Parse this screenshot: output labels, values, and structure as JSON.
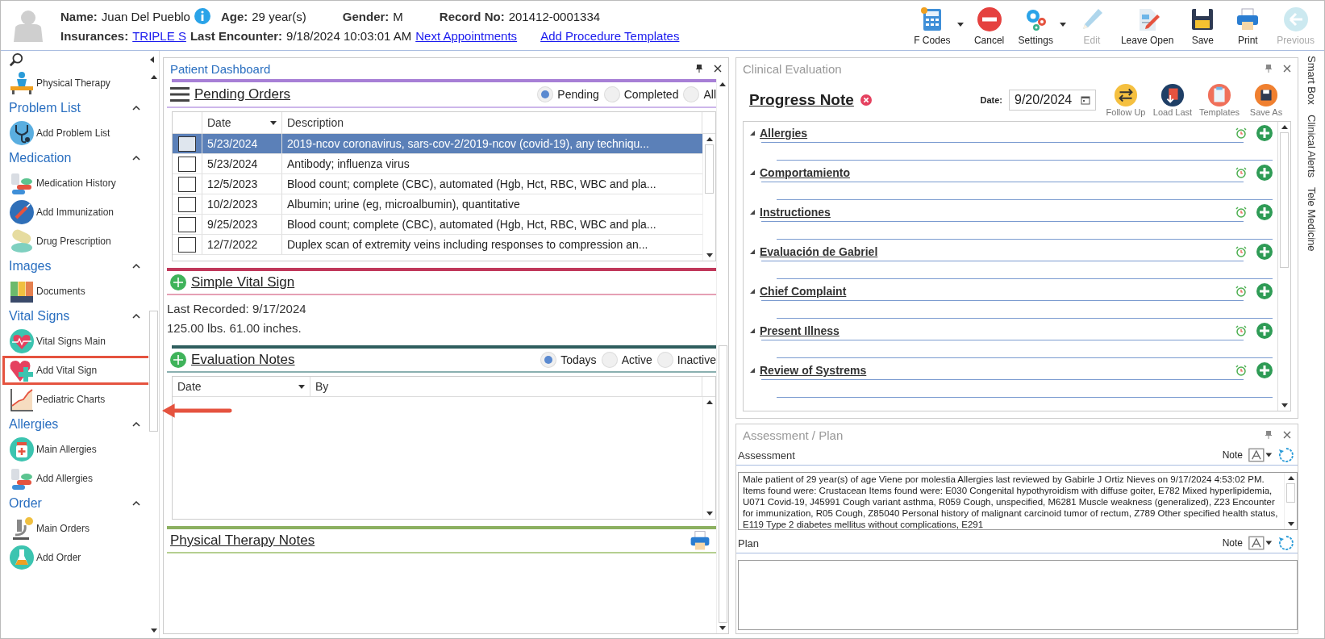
{
  "header": {
    "name_label": "Name:",
    "name": "Juan Del Pueblo",
    "age_label": "Age:",
    "age": "29 year(s)",
    "gender_label": "Gender:",
    "gender": "M",
    "record_label": "Record No:",
    "record": "201412-0001334",
    "insurances_label": "Insurances:",
    "insurance": "TRIPLE S",
    "last_encounter_label": "Last Encounter:",
    "last_encounter": "9/18/2024 10:03:01 AM",
    "links": [
      "Next Appointments",
      "Add Procedure Templates"
    ]
  },
  "toolbar": [
    {
      "label": "F Codes",
      "dropdown": true,
      "disabled": false
    },
    {
      "label": "Cancel",
      "dropdown": false,
      "disabled": false
    },
    {
      "label": "Settings",
      "dropdown": true,
      "disabled": false
    },
    {
      "label": "Edit",
      "dropdown": false,
      "disabled": true
    },
    {
      "label": "Leave Open",
      "dropdown": false,
      "disabled": false
    },
    {
      "label": "Save",
      "dropdown": false,
      "disabled": false
    },
    {
      "label": "Print",
      "dropdown": false,
      "disabled": false
    },
    {
      "label": "Previous",
      "dropdown": false,
      "disabled": true
    }
  ],
  "sidebar": {
    "top_items": [
      {
        "label": "Physical Therapy",
        "highlighted": false
      }
    ],
    "groups": [
      {
        "title": "Problem List",
        "expanded": true,
        "items": [
          {
            "label": "Add Problem List",
            "highlighted": false
          }
        ]
      },
      {
        "title": "Medication",
        "expanded": true,
        "items": [
          {
            "label": "Medication History",
            "highlighted": false
          },
          {
            "label": "Add Immunization",
            "highlighted": false
          },
          {
            "label": "Drug Prescription",
            "highlighted": false
          }
        ]
      },
      {
        "title": "Images",
        "expanded": true,
        "items": [
          {
            "label": "Documents",
            "highlighted": false
          }
        ]
      },
      {
        "title": "Vital Signs",
        "expanded": true,
        "items": [
          {
            "label": "Vital Signs Main",
            "highlighted": false
          },
          {
            "label": "Add Vital Sign",
            "highlighted": true
          },
          {
            "label": "Pediatric Charts",
            "highlighted": false
          }
        ]
      },
      {
        "title": "Allergies",
        "expanded": true,
        "items": [
          {
            "label": "Main Allergies",
            "highlighted": false
          },
          {
            "label": "Add Allergies",
            "highlighted": false
          }
        ]
      },
      {
        "title": "Order",
        "expanded": true,
        "items": [
          {
            "label": "Main Orders",
            "highlighted": false
          },
          {
            "label": "Add Order",
            "highlighted": false
          }
        ]
      }
    ]
  },
  "dashboard": {
    "title": "Patient Dashboard",
    "pending_orders": {
      "title": "Pending Orders",
      "filters": [
        {
          "label": "Pending",
          "selected": true
        },
        {
          "label": "Completed",
          "selected": false
        },
        {
          "label": "All",
          "selected": false
        }
      ],
      "columns": [
        "Date",
        "Description"
      ],
      "rows": [
        {
          "date": "5/23/2024",
          "description": "2019-ncov coronavirus, sars-cov-2/2019-ncov (covid-19), any techniqu...",
          "selected": true
        },
        {
          "date": "5/23/2024",
          "description": "Antibody; influenza virus",
          "selected": false
        },
        {
          "date": "12/5/2023",
          "description": "Blood count; complete (CBC), automated (Hgb, Hct, RBC, WBC and pla...",
          "selected": false
        },
        {
          "date": "10/2/2023",
          "description": "Albumin; urine (eg, microalbumin), quantitative",
          "selected": false
        },
        {
          "date": "9/25/2023",
          "description": "Blood count; complete (CBC), automated (Hgb, Hct, RBC, WBC and pla...",
          "selected": false
        },
        {
          "date": "12/7/2022",
          "description": "Duplex scan of extremity veins including responses to compression an...",
          "selected": false
        }
      ]
    },
    "vital_sign": {
      "title": "Simple Vital Sign",
      "lines": [
        "Last Recorded: 9/17/2024",
        "125.00 lbs. 61.00 inches."
      ]
    },
    "evaluation_notes": {
      "title": "Evaluation Notes",
      "filters": [
        {
          "label": "Todays",
          "selected": true
        },
        {
          "label": "Active",
          "selected": false
        },
        {
          "label": "Inactive",
          "selected": false
        }
      ],
      "columns": [
        "Date",
        "By"
      ]
    },
    "therapy_notes": {
      "title": "Physical Therapy Notes"
    }
  },
  "clinical_evaluation": {
    "title": "Clinical Evaluation",
    "note_title": "Progress Note",
    "date_label": "Date:",
    "date": "9/20/2024",
    "actions": [
      "Follow Up",
      "Load Last",
      "Templates",
      "Save As"
    ],
    "sections": [
      {
        "title": "Allergies",
        "expanded": true
      },
      {
        "title": "Comportamiento",
        "expanded": true
      },
      {
        "title": "Instructiones",
        "expanded": true
      },
      {
        "title": "Evaluación de Gabriel",
        "expanded": true
      },
      {
        "title": "Chief Complaint",
        "expanded": true
      },
      {
        "title": "Present Illness",
        "expanded": true
      },
      {
        "title": "Review of Systrems",
        "expanded": true
      }
    ]
  },
  "assessment_plan": {
    "title": "Assessment / Plan",
    "assessment_label": "Assessment",
    "assessment_note_label": "Note",
    "assessment_text": "Male patient of 29 year(s) of age Viene por molestia     Allergies last reviewed by Gabirle J Ortiz Nieves on 9/17/2024 4:53:02 PM.    Items found were:  Crustacean  Items found were:  E030 Congenital hypothyroidism with diffuse goiter, E782 Mixed hyperlipidemia, U071 Covid-19, J45991 Cough variant asthma, R059 Cough, unspecified, M6281 Muscle weakness (generalized), Z23 Encounter for immunization, R05 Cough, Z85040 Personal history of malignant carcinoid tumor of rectum, Z789 Other specified health status, E119 Type 2 diabetes mellitus without complications, E291",
    "plan_label": "Plan",
    "plan_note_label": "Note"
  },
  "side_tabs": [
    "Smart Box",
    "Clinical Alerts",
    "Tele Medicine"
  ]
}
